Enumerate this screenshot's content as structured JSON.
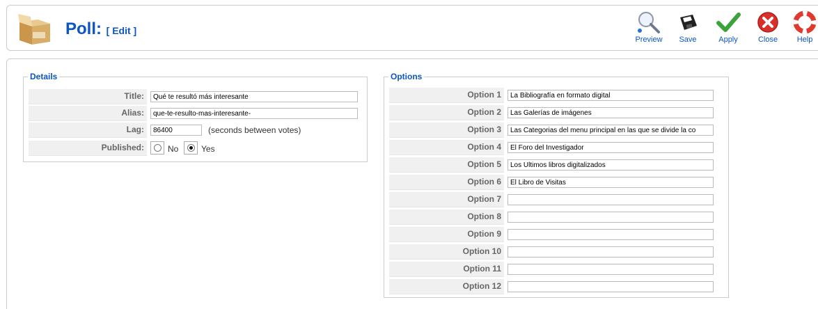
{
  "header": {
    "title": "Poll:",
    "subtitle": "[ Edit ]"
  },
  "toolbar": {
    "preview_label": "Preview",
    "save_label": "Save",
    "apply_label": "Apply",
    "close_label": "Close",
    "help_label": "Help",
    "icons": {
      "preview": "magnifier-icon",
      "save": "floppy-disk-icon",
      "apply": "checkmark-icon",
      "close": "close-circle-icon",
      "help": "lifebuoy-icon"
    },
    "colors": {
      "apply": "#3aa33a",
      "close": "#d9302c",
      "help": "#e03a2e",
      "link": "#0b55c4"
    }
  },
  "details": {
    "legend": "Details",
    "title_label": "Title:",
    "title_value": "Qué te resultó más interesante",
    "alias_label": "Alias:",
    "alias_value": "que-te-resulto-mas-interesante-",
    "lag_label": "Lag:",
    "lag_value": "86400",
    "lag_note": "(seconds between votes)",
    "published_label": "Published:",
    "no_label": "No",
    "yes_label": "Yes",
    "published": true
  },
  "options": {
    "legend": "Options",
    "items": [
      {
        "label": "Option 1",
        "value": "La Bibliografía en formato digital"
      },
      {
        "label": "Option 2",
        "value": "Las Galerías de imágenes"
      },
      {
        "label": "Option 3",
        "value": "Las Categorias del menu principal en las que se divide la co"
      },
      {
        "label": "Option 4",
        "value": "El Foro del Investigador"
      },
      {
        "label": "Option 5",
        "value": "Los Últimos libros digitalizados"
      },
      {
        "label": "Option 6",
        "value": "El Libro de Visitas"
      },
      {
        "label": "Option 7",
        "value": ""
      },
      {
        "label": "Option 8",
        "value": ""
      },
      {
        "label": "Option 9",
        "value": ""
      },
      {
        "label": "Option 10",
        "value": ""
      },
      {
        "label": "Option 11",
        "value": ""
      },
      {
        "label": "Option 12",
        "value": ""
      }
    ]
  }
}
